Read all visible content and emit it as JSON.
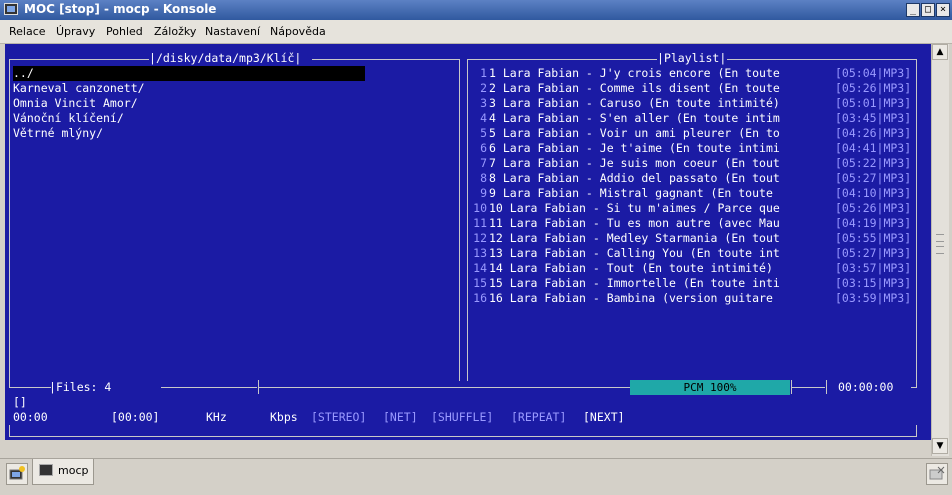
{
  "window": {
    "title": "MOC [stop] - mocp - Konsole",
    "buttons": [
      "min-icon",
      "max-icon",
      "close-icon"
    ]
  },
  "menu": [
    "Relace",
    "Úpravy",
    "Pohled",
    "Záložky",
    "Nastavení",
    "Nápověda"
  ],
  "browser": {
    "path": "/disky/data/mp3/Klíč",
    "entries": [
      "../",
      "Karneval canzonett/",
      "Omnia Vincit Amor/",
      "Vánoční klíčení/",
      "Větrné mlýny/"
    ],
    "files_label": "Files: 4"
  },
  "playlist": {
    "title": "Playlist",
    "items": [
      {
        "n": "1",
        "title": "1 Lara Fabian - J'y crois encore (En toute",
        "time": "[05:04|MP3]"
      },
      {
        "n": "2",
        "title": "2 Lara Fabian - Comme ils disent (En toute",
        "time": "[05:26|MP3]"
      },
      {
        "n": "3",
        "title": "3 Lara Fabian - Caruso (En toute intimité)",
        "time": "[05:01|MP3]"
      },
      {
        "n": "4",
        "title": "4 Lara Fabian - S'en aller (En toute intim",
        "time": "[03:45|MP3]"
      },
      {
        "n": "5",
        "title": "5 Lara Fabian - Voir un ami pleurer (En to",
        "time": "[04:26|MP3]"
      },
      {
        "n": "6",
        "title": "6 Lara Fabian - Je t'aime (En toute intimi",
        "time": "[04:41|MP3]"
      },
      {
        "n": "7",
        "title": "7 Lara Fabian - Je suis mon coeur (En tout",
        "time": "[05:22|MP3]"
      },
      {
        "n": "8",
        "title": "8 Lara Fabian - Addio del passato (En tout",
        "time": "[05:27|MP3]"
      },
      {
        "n": "9",
        "title": "9 Lara Fabian - Mistral gagnant (En toute ",
        "time": "[04:10|MP3]"
      },
      {
        "n": "10",
        "title": "10 Lara Fabian - Si tu m'aimes / Parce que",
        "time": "[05:26|MP3]"
      },
      {
        "n": "11",
        "title": "11 Lara Fabian - Tu es mon autre (avec Mau",
        "time": "[04:19|MP3]"
      },
      {
        "n": "12",
        "title": "12 Lara Fabian - Medley Starmania (En tout",
        "time": "[05:55|MP3]"
      },
      {
        "n": "13",
        "title": "13 Lara Fabian - Calling You (En toute int",
        "time": "[05:27|MP3]"
      },
      {
        "n": "14",
        "title": "14 Lara Fabian - Tout (En toute intimité)",
        "time": "[03:57|MP3]"
      },
      {
        "n": "15",
        "title": "15 Lara Fabian - Immortelle (En toute inti",
        "time": "[03:15|MP3]"
      },
      {
        "n": "16",
        "title": "16 Lara Fabian - Bambina (version guitare ",
        "time": "[03:59|MP3]"
      }
    ]
  },
  "status": {
    "volume": "PCM 100%",
    "total_time": "00:00:00",
    "current_file": "[]",
    "elapsed": "00:00",
    "duration": "[00:00]",
    "khz": "KHz",
    "kbps": "Kbps",
    "flags": [
      {
        "label": "[STEREO]",
        "active": false
      },
      {
        "label": "[NET]",
        "active": false
      },
      {
        "label": "[SHUFFLE]",
        "active": false
      },
      {
        "label": "[REPEAT]",
        "active": false
      },
      {
        "label": "[NEXT]",
        "active": true
      }
    ]
  },
  "tabs": [
    {
      "label": "mocp"
    }
  ],
  "colors": {
    "terminal_bg": "#1b1ba4",
    "dim_text": "#9a9aff",
    "volume_bar": "#1fa8a8"
  }
}
